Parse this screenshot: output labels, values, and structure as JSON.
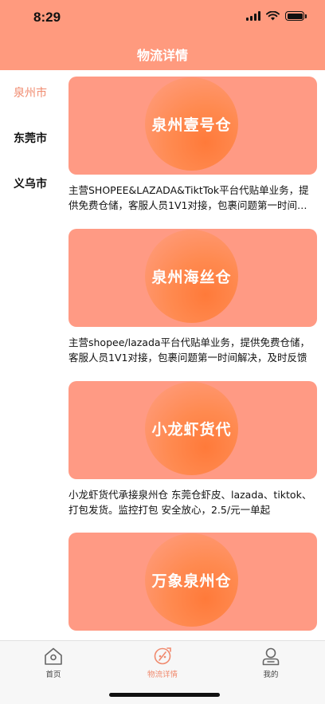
{
  "status_bar": {
    "time": "8:29",
    "icons": [
      "signal-icon",
      "wifi-icon",
      "battery-icon"
    ]
  },
  "header": {
    "title": "物流详情",
    "background_color": "#FF9A7E"
  },
  "city_nav": {
    "items": [
      {
        "label": "泉州市",
        "active": true
      },
      {
        "label": "东莞市",
        "active": false
      },
      {
        "label": "义乌市",
        "active": false
      }
    ],
    "active_color": "#F08A6E"
  },
  "warehouses": [
    {
      "name": "泉州壹号仓",
      "description": "主营SHOPEE&LAZADA&TiktTok平台代贴单业务，提供免费仓储，客服人员1V1对接，包裹问题第一时间解决"
    },
    {
      "name": "泉州海丝仓",
      "description": "主营shopee/lazada平台代贴单业务，提供免费仓储，客服人员1V1对接，包裹问题第一时间解决，及时反馈"
    },
    {
      "name": "小龙虾货代",
      "description": "小龙虾货代承接泉州仓 东莞仓虾皮、lazada、tiktok、打包发货。监控打包 安全放心，2.5/元一单起"
    },
    {
      "name": "万象泉州仓",
      "description": ""
    }
  ],
  "tabbar": {
    "items": [
      {
        "label": "首页",
        "icon": "home-icon",
        "active": false
      },
      {
        "label": "物流详情",
        "icon": "logistics-icon",
        "active": true
      },
      {
        "label": "我的",
        "icon": "user-icon",
        "active": false
      }
    ]
  }
}
